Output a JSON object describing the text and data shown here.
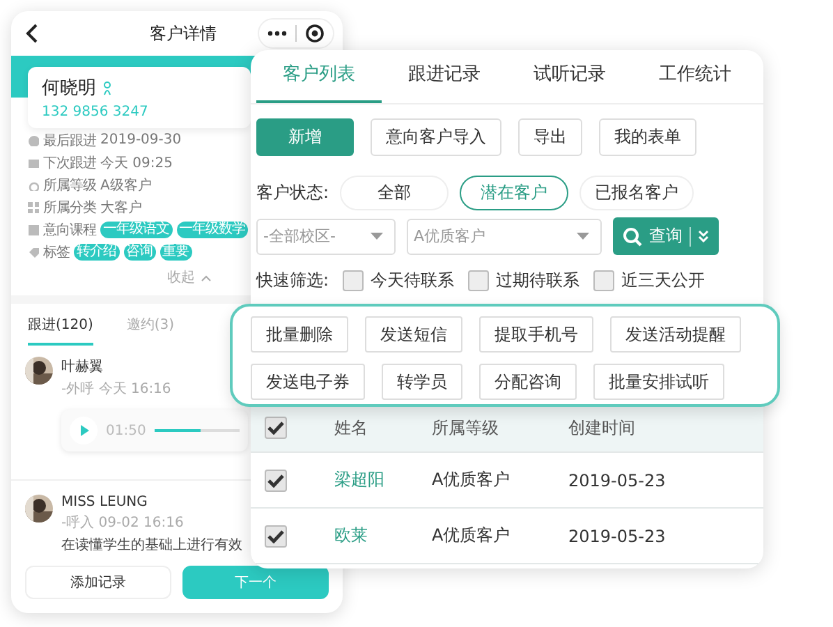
{
  "mobile": {
    "title": "客户详情",
    "customer": {
      "name": "何晓明",
      "phone": "132 9856 3247"
    },
    "info": [
      {
        "label": "最后跟进",
        "value": "2019-09-30"
      },
      {
        "label": "下次跟进",
        "value": "今天 09:25"
      },
      {
        "label": "所属等级",
        "value": "A级客户"
      },
      {
        "label": "所属分类",
        "value": "大客户"
      },
      {
        "label": "意向课程",
        "tags": [
          "一年级语文",
          "一年级数学"
        ]
      },
      {
        "label": "标签",
        "tags": [
          "转介绍",
          "咨询",
          "重要"
        ]
      }
    ],
    "collapse": "收起",
    "tabs": [
      {
        "label": "跟进(120)",
        "selected": true
      },
      {
        "label": "邀约(3)",
        "selected": false
      }
    ],
    "records": [
      {
        "name": "叶赫翼",
        "meta": "-外呼  今天 16:16",
        "audio": {
          "time": "01:50",
          "level": 0.55
        }
      },
      {
        "name": "MISS LEUNG",
        "meta": "-呼入  09-02 16:16",
        "text": "在读懂学生的基础上进行有效"
      }
    ],
    "buttons": [
      {
        "label": "添加记录",
        "kind": "secondary"
      },
      {
        "label": "下一个",
        "kind": "primary"
      }
    ]
  },
  "panel": {
    "tabs": [
      {
        "label": "客户列表",
        "selected": true
      },
      {
        "label": "跟进记录",
        "selected": false
      },
      {
        "label": "试听记录",
        "selected": false
      },
      {
        "label": "工作统计",
        "selected": false
      }
    ],
    "actions": [
      {
        "label": "新增",
        "kind": "primary"
      },
      {
        "label": "意向客户导入",
        "kind": "secondary"
      },
      {
        "label": "导出",
        "kind": "secondary"
      },
      {
        "label": "我的表单",
        "kind": "secondary"
      }
    ],
    "status": {
      "label": "客户状态:",
      "options": [
        {
          "label": "全部",
          "selected": false
        },
        {
          "label": "潜在客户",
          "selected": true
        },
        {
          "label": "已报名客户",
          "selected": false
        }
      ]
    },
    "selects": [
      {
        "value": "-全部校区-"
      },
      {
        "value": "A优质客户"
      }
    ],
    "search_button": "查询",
    "quick_filter": {
      "label": "快速筛选:",
      "options": [
        {
          "label": "今天待联系",
          "checked": false
        },
        {
          "label": "过期待联系",
          "checked": false
        },
        {
          "label": "近三天公开",
          "checked": false
        }
      ]
    },
    "table": {
      "columns": [
        "姓名",
        "所属等级",
        "创建时间"
      ],
      "header_checked": true,
      "rows": [
        {
          "name": "梁超阳",
          "grade": "A优质客户",
          "created": "2019-05-23",
          "checked": true
        },
        {
          "name": "欧莱",
          "grade": "A优质客户",
          "created": "2019-05-23",
          "checked": true
        }
      ]
    }
  },
  "bulk_actions": [
    [
      "批量删除",
      "发送短信",
      "提取手机号",
      "发送活动提醒"
    ],
    [
      "发送电子券",
      "转学员",
      "分配咨询",
      "批量安排试听"
    ]
  ]
}
